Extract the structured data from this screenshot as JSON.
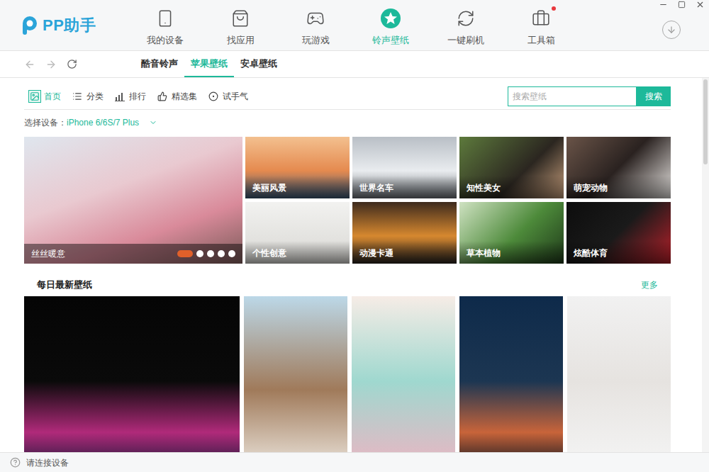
{
  "app": {
    "name": "PP助手"
  },
  "nav": [
    {
      "label": "我的设备",
      "selected": false,
      "badge": false
    },
    {
      "label": "找应用",
      "selected": false,
      "badge": false
    },
    {
      "label": "玩游戏",
      "selected": false,
      "badge": false
    },
    {
      "label": "铃声壁纸",
      "selected": true,
      "badge": false
    },
    {
      "label": "一键刷机",
      "selected": false,
      "badge": false
    },
    {
      "label": "工具箱",
      "selected": false,
      "badge": true
    }
  ],
  "sub_tabs": [
    {
      "label": "酷音铃声",
      "selected": false
    },
    {
      "label": "苹果壁纸",
      "selected": true
    },
    {
      "label": "安卓壁纸",
      "selected": false
    }
  ],
  "views": [
    {
      "label": "首页",
      "selected": true
    },
    {
      "label": "分类",
      "selected": false
    },
    {
      "label": "排行",
      "selected": false
    },
    {
      "label": "精选集",
      "selected": false
    },
    {
      "label": "试手气",
      "selected": false
    }
  ],
  "search": {
    "placeholder": "搜索壁纸",
    "button": "搜索"
  },
  "device": {
    "label": "选择设备：",
    "value": "iPhone 6/6S/7 Plus"
  },
  "featured": {
    "caption": "丝丝暖意",
    "slides": [
      {
        "selected": true
      },
      {
        "selected": false
      },
      {
        "selected": false
      },
      {
        "selected": false
      },
      {
        "selected": false
      }
    ]
  },
  "categories": [
    {
      "label": "美丽风景"
    },
    {
      "label": "世界名车"
    },
    {
      "label": "知性美女"
    },
    {
      "label": "萌宠动物"
    },
    {
      "label": "个性创意"
    },
    {
      "label": "动漫卡通"
    },
    {
      "label": "草本植物"
    },
    {
      "label": "炫酷体育"
    }
  ],
  "latest": {
    "title": "每日最新壁纸",
    "more": "更多"
  },
  "status_bar": {
    "text": "请连接设备"
  }
}
